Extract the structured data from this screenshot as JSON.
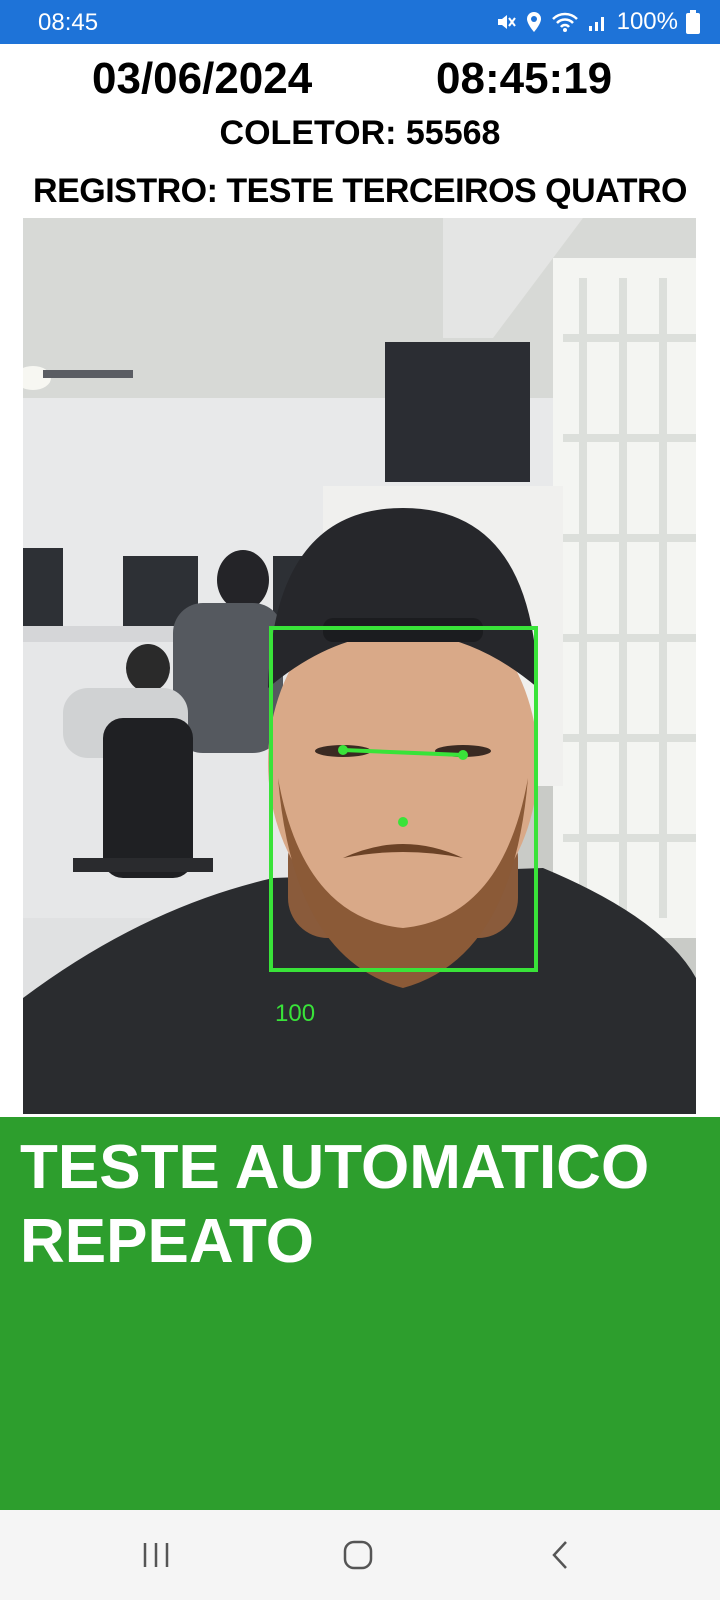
{
  "status_bar": {
    "time": "08:45",
    "battery": "100%",
    "icons": [
      "mute-vibrate-icon",
      "location-icon",
      "wifi-icon",
      "signal-icon",
      "battery-icon"
    ]
  },
  "header": {
    "date": "03/06/2024",
    "clock": "08:45:19",
    "collector": "COLETOR: 55568",
    "registro": "REGISTRO: TESTE TERCEIROS QUATRO"
  },
  "camera": {
    "face_score": "100",
    "overlay_color": "#39e339"
  },
  "result": {
    "line1": "TESTE AUTOMATICO",
    "line2": "REPEATO",
    "color": "#2d9e2d"
  },
  "nav_bar": {
    "buttons": [
      "recent-apps-icon",
      "home-icon",
      "back-icon"
    ]
  }
}
